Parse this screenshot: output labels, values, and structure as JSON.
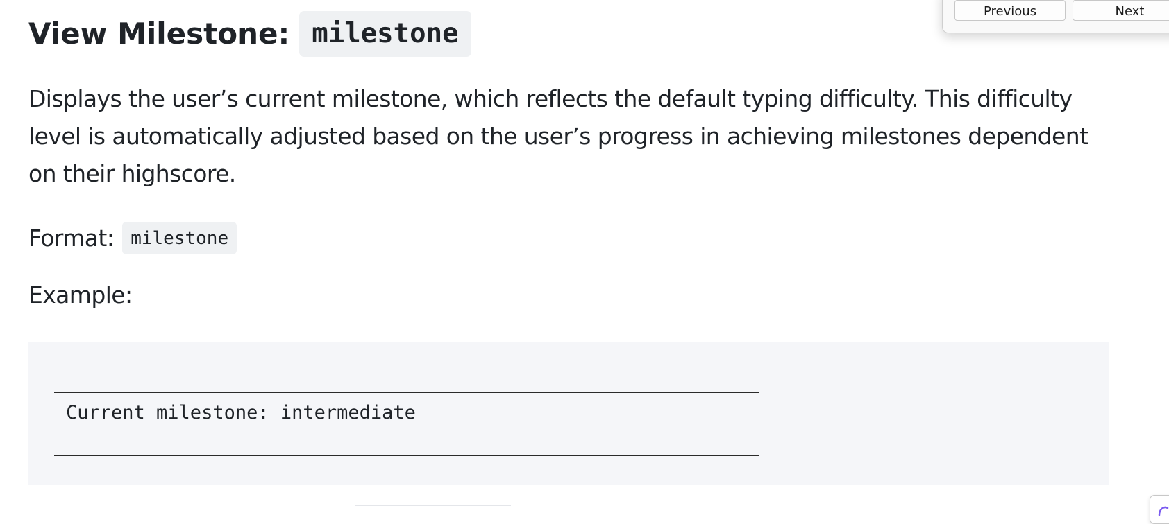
{
  "heading": {
    "prefix": "View Milestone:",
    "code": "milestone"
  },
  "description": "Displays the user’s current milestone, which reflects the default typing difficulty. This difficulty level is automatically adjusted based on the user’s progress in achieving milestones dependent on their highscore.",
  "format": {
    "label": "Format:",
    "code": "milestone"
  },
  "example": {
    "label": "Example:",
    "output_line": "Current milestone: intermediate"
  },
  "find_popup": {
    "previous_label": "Previous",
    "next_label": "Next"
  },
  "corner_widget": {
    "icon": "assistant-icon",
    "accent_color": "#7b5cf0"
  }
}
